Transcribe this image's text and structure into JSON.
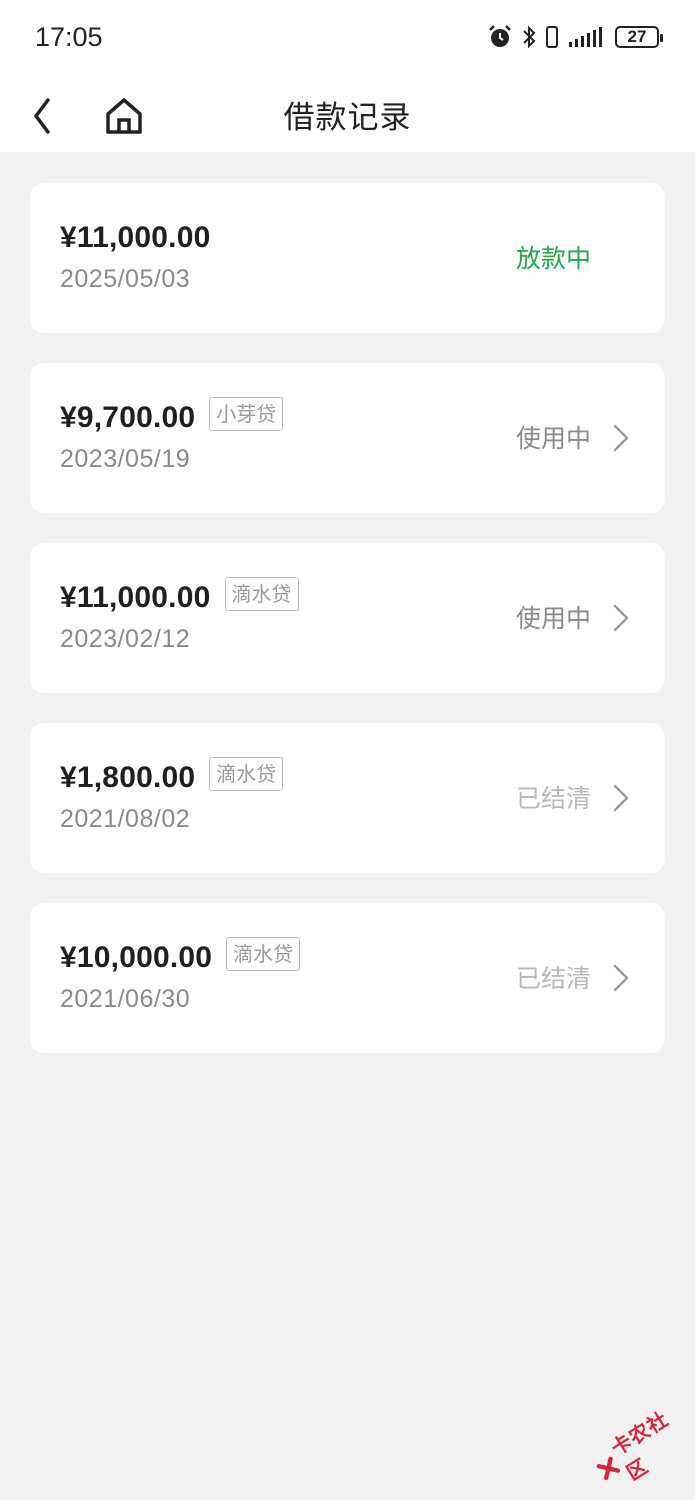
{
  "status_bar": {
    "time": "17:05",
    "battery": "27",
    "icons": [
      "alarm-icon",
      "bluetooth-icon",
      "vibrate-icon",
      "signal-icon",
      "battery-icon"
    ]
  },
  "header": {
    "title": "借款记录",
    "back_icon": "chevron-left-icon",
    "home_icon": "home-icon"
  },
  "colors": {
    "status_green": "#22a84a",
    "status_inuse": "#8a8a8a",
    "status_done": "#b8b8b8",
    "background": "#f2f2f2"
  },
  "loans": [
    {
      "amount": "¥11,000.00",
      "tag": "",
      "date": "2025/05/03",
      "status": "放款中"
    },
    {
      "amount": "¥9,700.00",
      "tag": "小芽贷",
      "date": "2023/05/19",
      "status": "使用中"
    },
    {
      "amount": "¥11,000.00",
      "tag": "滴水贷",
      "date": "2023/02/12",
      "status": "使用中"
    },
    {
      "amount": "¥1,800.00",
      "tag": "滴水贷",
      "date": "2021/08/02",
      "status": "已结清"
    },
    {
      "amount": "¥10,000.00",
      "tag": "滴水贷",
      "date": "2021/06/30",
      "status": "已结清"
    }
  ],
  "watermark": {
    "text": "卡农社区"
  }
}
